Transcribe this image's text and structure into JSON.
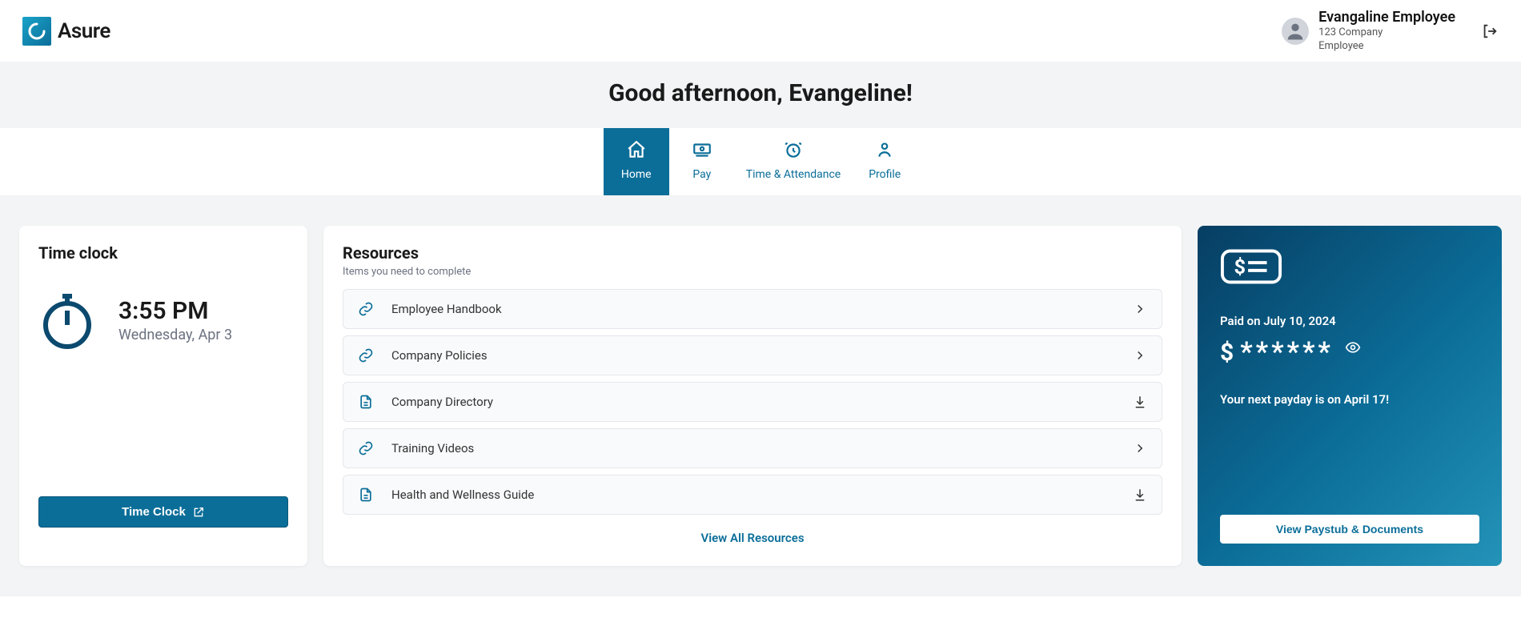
{
  "header": {
    "brand": "Asure",
    "user_name": "Evangaline Employee",
    "user_company": "123 Company",
    "user_role": "Employee"
  },
  "banner": {
    "greeting": "Good afternoon, Evangeline!"
  },
  "nav": {
    "home": "Home",
    "pay": "Pay",
    "time_attendance": "Time & Attendance",
    "profile": "Profile"
  },
  "time_clock": {
    "title": "Time clock",
    "time": "3:55 PM",
    "date": "Wednesday, Apr 3",
    "button": "Time Clock"
  },
  "resources": {
    "title": "Resources",
    "subtitle": "Items you need to complete",
    "items": [
      {
        "label": "Employee Handbook",
        "icon": "link",
        "action": "chevron"
      },
      {
        "label": "Company Policies",
        "icon": "link",
        "action": "chevron"
      },
      {
        "label": "Company Directory",
        "icon": "doc",
        "action": "download"
      },
      {
        "label": "Training Videos",
        "icon": "link",
        "action": "chevron"
      },
      {
        "label": "Health and Wellness Guide",
        "icon": "doc",
        "action": "download"
      }
    ],
    "view_all": "View All Resources"
  },
  "pay": {
    "paid_on": "Paid on July 10, 2024",
    "amount_masked": "******",
    "next_payday": "Your next payday is on April 17!",
    "button": "View Paystub & Documents"
  }
}
